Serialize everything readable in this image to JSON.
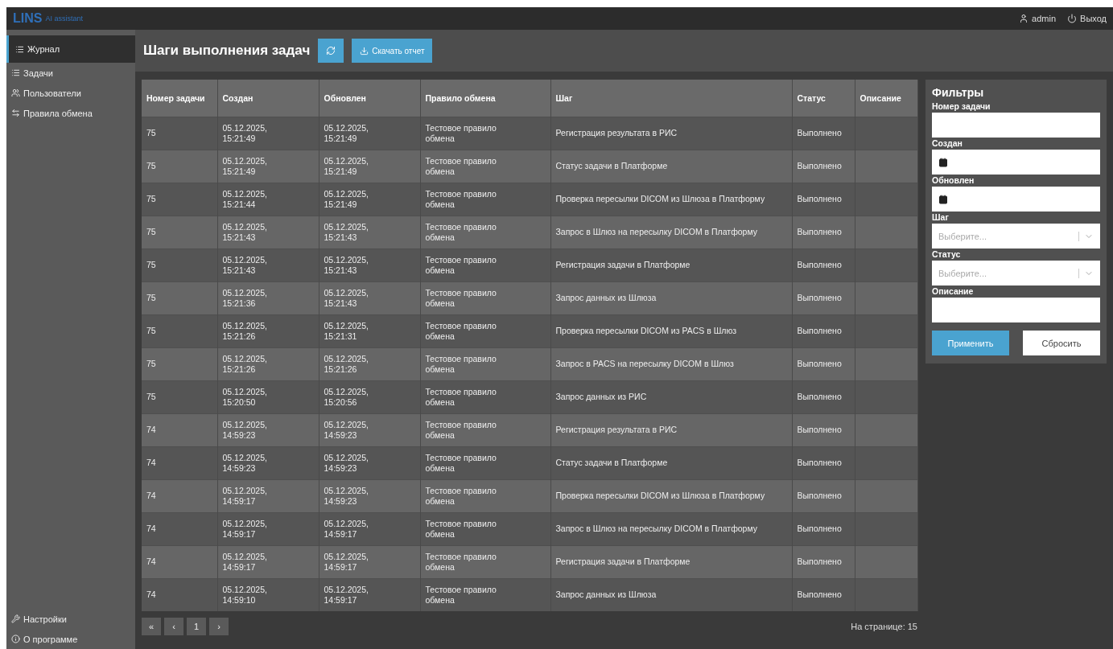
{
  "topbar": {
    "logo": "LINS",
    "logo_sub": "AI assistant",
    "user": "admin",
    "logout": "Выход"
  },
  "sidebar": {
    "items": [
      {
        "label": "Журнал",
        "selected": true
      },
      {
        "label": "Задачи",
        "selected": false
      },
      {
        "label": "Пользователи",
        "selected": false
      },
      {
        "label": "Правила обмена",
        "selected": false
      }
    ],
    "bottom_items": [
      {
        "label": "Настройки"
      },
      {
        "label": "О программе"
      }
    ]
  },
  "header": {
    "title": "Шаги выполнения задач",
    "download_button": "Скачать отчет"
  },
  "table": {
    "columns": [
      "Номер задачи",
      "Создан",
      "Обновлен",
      "Правило обмена",
      "Шаг",
      "Статус",
      "Описание"
    ],
    "rows": [
      [
        "75",
        "05.12.2025, 15:21:49",
        "05.12.2025, 15:21:49",
        "Тестовое правило обмена",
        "Регистрация результата в РИС",
        "Выполнено"
      ],
      [
        "75",
        "05.12.2025, 15:21:49",
        "05.12.2025, 15:21:49",
        "Тестовое правило обмена",
        "Статус задачи в Платформе",
        "Выполнено"
      ],
      [
        "75",
        "05.12.2025, 15:21:44",
        "05.12.2025, 15:21:49",
        "Тестовое правило обмена",
        "Проверка пересылки DICOM из Шлюза в Платформу",
        "Выполнено"
      ],
      [
        "75",
        "05.12.2025, 15:21:43",
        "05.12.2025, 15:21:43",
        "Тестовое правило обмена",
        "Запрос в Шлюз на пересылку DICOM в Платформу",
        "Выполнено"
      ],
      [
        "75",
        "05.12.2025, 15:21:43",
        "05.12.2025, 15:21:43",
        "Тестовое правило обмена",
        "Регистрация задачи в Платформе",
        "Выполнено"
      ],
      [
        "75",
        "05.12.2025, 15:21:36",
        "05.12.2025, 15:21:43",
        "Тестовое правило обмена",
        "Запрос данных из Шлюза",
        "Выполнено"
      ],
      [
        "75",
        "05.12.2025, 15:21:26",
        "05.12.2025, 15:21:31",
        "Тестовое правило обмена",
        "Проверка пересылки DICOM из PACS в Шлюз",
        "Выполнено"
      ],
      [
        "75",
        "05.12.2025, 15:21:26",
        "05.12.2025, 15:21:26",
        "Тестовое правило обмена",
        "Запрос в PACS на пересылку DICOM в Шлюз",
        "Выполнено"
      ],
      [
        "75",
        "05.12.2025, 15:20:50",
        "05.12.2025, 15:20:56",
        "Тестовое правило обмена",
        "Запрос данных из РИС",
        "Выполнено"
      ],
      [
        "74",
        "05.12.2025, 14:59:23",
        "05.12.2025, 14:59:23",
        "Тестовое правило обмена",
        "Регистрация результата в РИС",
        "Выполнено"
      ],
      [
        "74",
        "05.12.2025, 14:59:23",
        "05.12.2025, 14:59:23",
        "Тестовое правило обмена",
        "Статус задачи в Платформе",
        "Выполнено"
      ],
      [
        "74",
        "05.12.2025, 14:59:17",
        "05.12.2025, 14:59:23",
        "Тестовое правило обмена",
        "Проверка пересылки DICOM из Шлюза в Платформу",
        "Выполнено"
      ],
      [
        "74",
        "05.12.2025, 14:59:17",
        "05.12.2025, 14:59:17",
        "Тестовое правило обмена",
        "Запрос в Шлюз на пересылку DICOM в Платформу",
        "Выполнено"
      ],
      [
        "74",
        "05.12.2025, 14:59:17",
        "05.12.2025, 14:59:17",
        "Тестовое правило обмена",
        "Регистрация задачи в Платформе",
        "Выполнено"
      ],
      [
        "74",
        "05.12.2025, 14:59:10",
        "05.12.2025, 14:59:17",
        "Тестовое правило обмена",
        "Запрос данных из Шлюза",
        "Выполнено"
      ]
    ]
  },
  "pagination": {
    "buttons": [
      "«",
      "‹",
      "1",
      "›"
    ],
    "page_size": "На странице: 15"
  },
  "filters": {
    "title": "Фильтры",
    "fields": [
      {
        "label": "Номер задачи",
        "kind": "text"
      },
      {
        "label": "Создан",
        "kind": "date"
      },
      {
        "label": "Обновлен",
        "kind": "date"
      },
      {
        "label": "Шаг",
        "kind": "select",
        "placeholder": "Выберите..."
      },
      {
        "label": "Статус",
        "kind": "select",
        "placeholder": "Выберите..."
      },
      {
        "label": "Описание",
        "kind": "text"
      }
    ],
    "apply_button": "Применить",
    "reset_button": "Сбросить"
  }
}
